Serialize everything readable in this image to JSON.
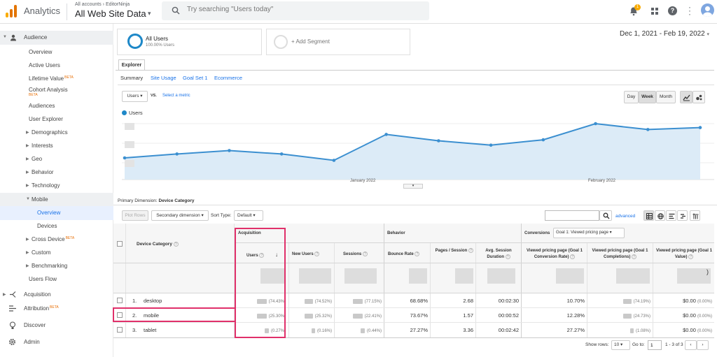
{
  "app": {
    "name": "Analytics",
    "breadcrumb": "All accounts › EditorNinja",
    "view": "All Web Site Data"
  },
  "search": {
    "placeholder": "Try searching \"Users today\""
  },
  "notifications": {
    "count": "1"
  },
  "sidebar": {
    "sections": [
      {
        "label": "Audience"
      },
      {
        "label": "Acquisition"
      },
      {
        "label": "Attribution",
        "badge": "BETA"
      },
      {
        "label": "Discover"
      },
      {
        "label": "Admin"
      }
    ],
    "items": [
      {
        "label": "Overview"
      },
      {
        "label": "Active Users"
      },
      {
        "label": "Lifetime Value",
        "badge": "BETA"
      },
      {
        "label": "Cohort Analysis",
        "badge": "BETA"
      },
      {
        "label": "Audiences"
      },
      {
        "label": "User Explorer"
      },
      {
        "label": "Demographics"
      },
      {
        "label": "Interests"
      },
      {
        "label": "Geo"
      },
      {
        "label": "Behavior"
      },
      {
        "label": "Technology"
      },
      {
        "label": "Mobile"
      },
      {
        "label": "Overview"
      },
      {
        "label": "Devices"
      },
      {
        "label": "Cross Device",
        "badge": "BETA"
      },
      {
        "label": "Custom"
      },
      {
        "label": "Benchmarking"
      },
      {
        "label": "Users Flow"
      }
    ]
  },
  "segments": {
    "active": "All Users",
    "active_sub": "100.00% Users",
    "add": "+ Add Segment"
  },
  "date_range": "Dec 1, 2021 - Feb 19, 2022",
  "tabs": {
    "explorer": "Explorer",
    "subtabs": [
      "Summary",
      "Site Usage",
      "Goal Set 1",
      "Ecommerce"
    ]
  },
  "chart_controls": {
    "metric": "Users",
    "vs": "VS.",
    "select_metric": "Select a metric",
    "periods": [
      "Day",
      "Week",
      "Month"
    ],
    "active_period": "Week"
  },
  "chart_data": {
    "type": "line",
    "series": [
      {
        "name": "Users",
        "values": [
          0.3,
          0.38,
          0.45,
          0.38,
          0.25,
          0.78,
          0.65,
          0.56,
          0.67,
          1.0,
          0.88,
          0.92
        ]
      }
    ],
    "x_ticks": [
      "January 2022",
      "February 2022"
    ],
    "color": "#3b8fd0"
  },
  "primary_dimension": {
    "label": "Primary Dimension:",
    "value": "Device Category"
  },
  "table_controls": {
    "plot_rows": "Plot Rows",
    "secondary": "Secondary dimension",
    "sort_type": "Sort Type:",
    "sort_value": "Default",
    "advanced": "advanced"
  },
  "table": {
    "group_headers": {
      "acquisition": "Acquisition",
      "behavior": "Behavior",
      "conversions": "Conversions",
      "goal": "Goal 1: Viewed pricing page"
    },
    "dimension_header": "Device Category",
    "columns": [
      "Users",
      "New Users",
      "Sessions",
      "Bounce Rate",
      "Pages / Session",
      "Avg. Session Duration",
      "Viewed pricing page (Goal 1 Conversion Rate)",
      "Viewed pricing page (Goal 1 Completions)",
      "Viewed pricing page (Goal 1 Value)"
    ],
    "rows": [
      {
        "index": "1.",
        "name": "desktop",
        "users_pct": "(74.43%)",
        "new_pct": "(74.52%)",
        "sessions_pct": "(77.15%)",
        "bounce": "68.68%",
        "pages": "2.68",
        "duration": "00:02:30",
        "conv_rate": "10.70%",
        "completions_pct": "(74.19%)",
        "value": "$0.00",
        "value_pct": "(0.00%)"
      },
      {
        "index": "2.",
        "name": "mobile",
        "users_pct": "(25.30%)",
        "new_pct": "(25.32%)",
        "sessions_pct": "(22.41%)",
        "bounce": "73.67%",
        "pages": "1.57",
        "duration": "00:00:52",
        "conv_rate": "12.28%",
        "completions_pct": "(24.73%)",
        "value": "$0.00",
        "value_pct": "(0.00%)"
      },
      {
        "index": "3.",
        "name": "tablet",
        "users_pct": "(0.27%)",
        "new_pct": "(0.16%)",
        "sessions_pct": "(0.44%)",
        "bounce": "27.27%",
        "pages": "3.36",
        "duration": "00:02:42",
        "conv_rate": "27.27%",
        "completions_pct": "(1.08%)",
        "value": "$0.00",
        "value_pct": "(0.00%)"
      }
    ]
  },
  "pagination": {
    "show_rows": "Show rows:",
    "rows_value": "10",
    "goto": "Go to:",
    "goto_value": "1",
    "range": "1 - 3 of 3"
  },
  "colors": {
    "highlight": "#e0306a",
    "accent": "#1a73e8",
    "line": "#3b8fd0"
  }
}
